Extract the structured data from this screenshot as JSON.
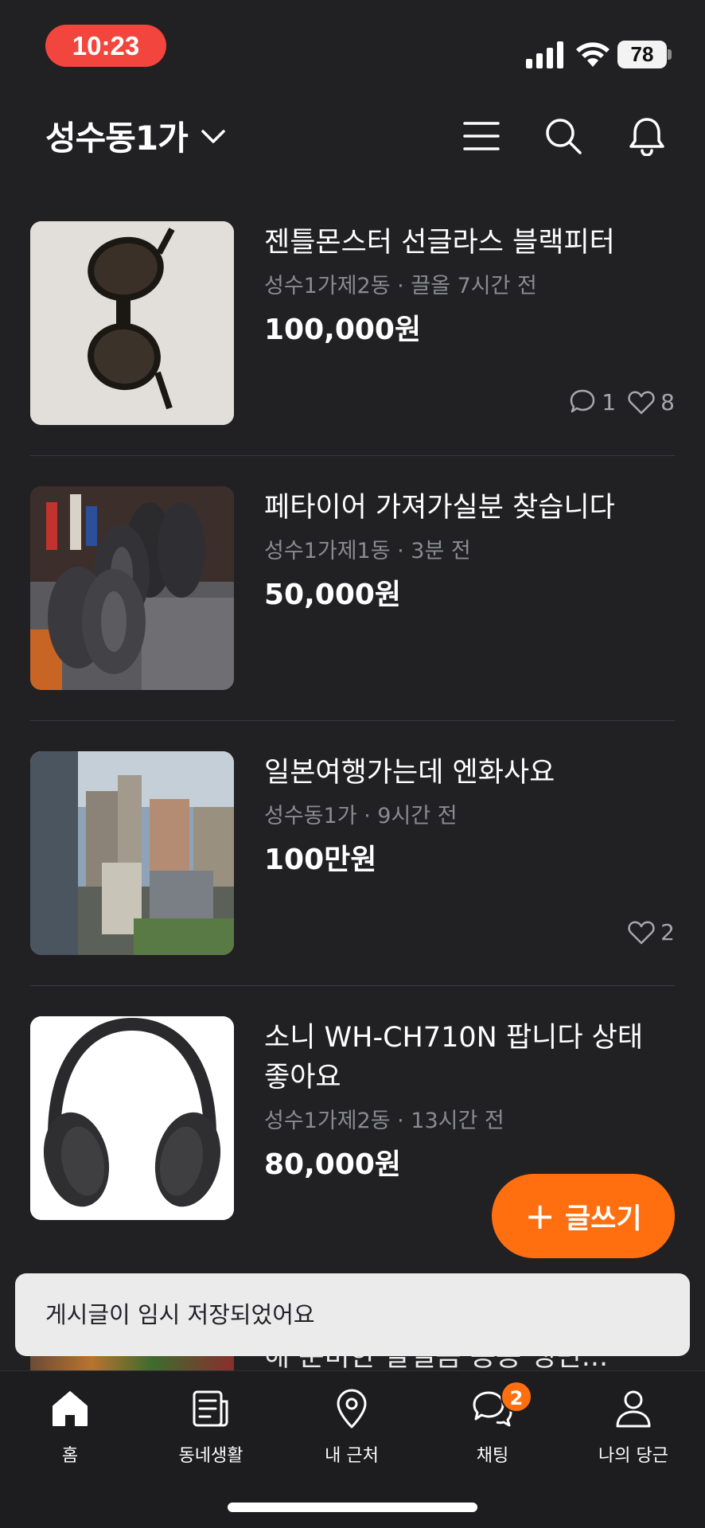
{
  "status_bar": {
    "time": "10:23",
    "battery": "78"
  },
  "header": {
    "location": "성수동1가"
  },
  "items": [
    {
      "title": "젠틀몬스터 선글라스 블랙피터",
      "meta": "성수1가제2동 · 끌올 7시간 전",
      "price": "100,000원",
      "comments": "1",
      "likes": "8"
    },
    {
      "title": "페타이어 가져가실분 찾습니다",
      "meta": "성수1가제1동 · 3분 전",
      "price": "50,000원"
    },
    {
      "title": "일본여행가는데 엔화사요",
      "meta": "성수동1가 · 9시간 전",
      "price": "100만원",
      "likes": "2"
    },
    {
      "title": "소니 WH-CH710N 팝니다 상태 좋아요",
      "meta": "성수1가제2동 · 13시간 전",
      "price": "80,000원"
    }
  ],
  "partial_item": {
    "title": "해 준비한 살얼음 동동 냉면..."
  },
  "fab": {
    "label": "글쓰기"
  },
  "toast": {
    "message": "게시글이 임시 저장되었어요"
  },
  "tabbar": {
    "tabs": [
      {
        "label": "홈",
        "icon": "home-icon"
      },
      {
        "label": "동네생활",
        "icon": "newspaper-icon"
      },
      {
        "label": "내 근처",
        "icon": "location-pin-icon"
      },
      {
        "label": "채팅",
        "icon": "chat-icon",
        "badge": "2"
      },
      {
        "label": "나의 당근",
        "icon": "person-icon"
      }
    ]
  },
  "colors": {
    "background": "#212124",
    "accent": "#ff6f0f",
    "time_pill": "#f2453d",
    "meta_text": "#8a8b90"
  }
}
